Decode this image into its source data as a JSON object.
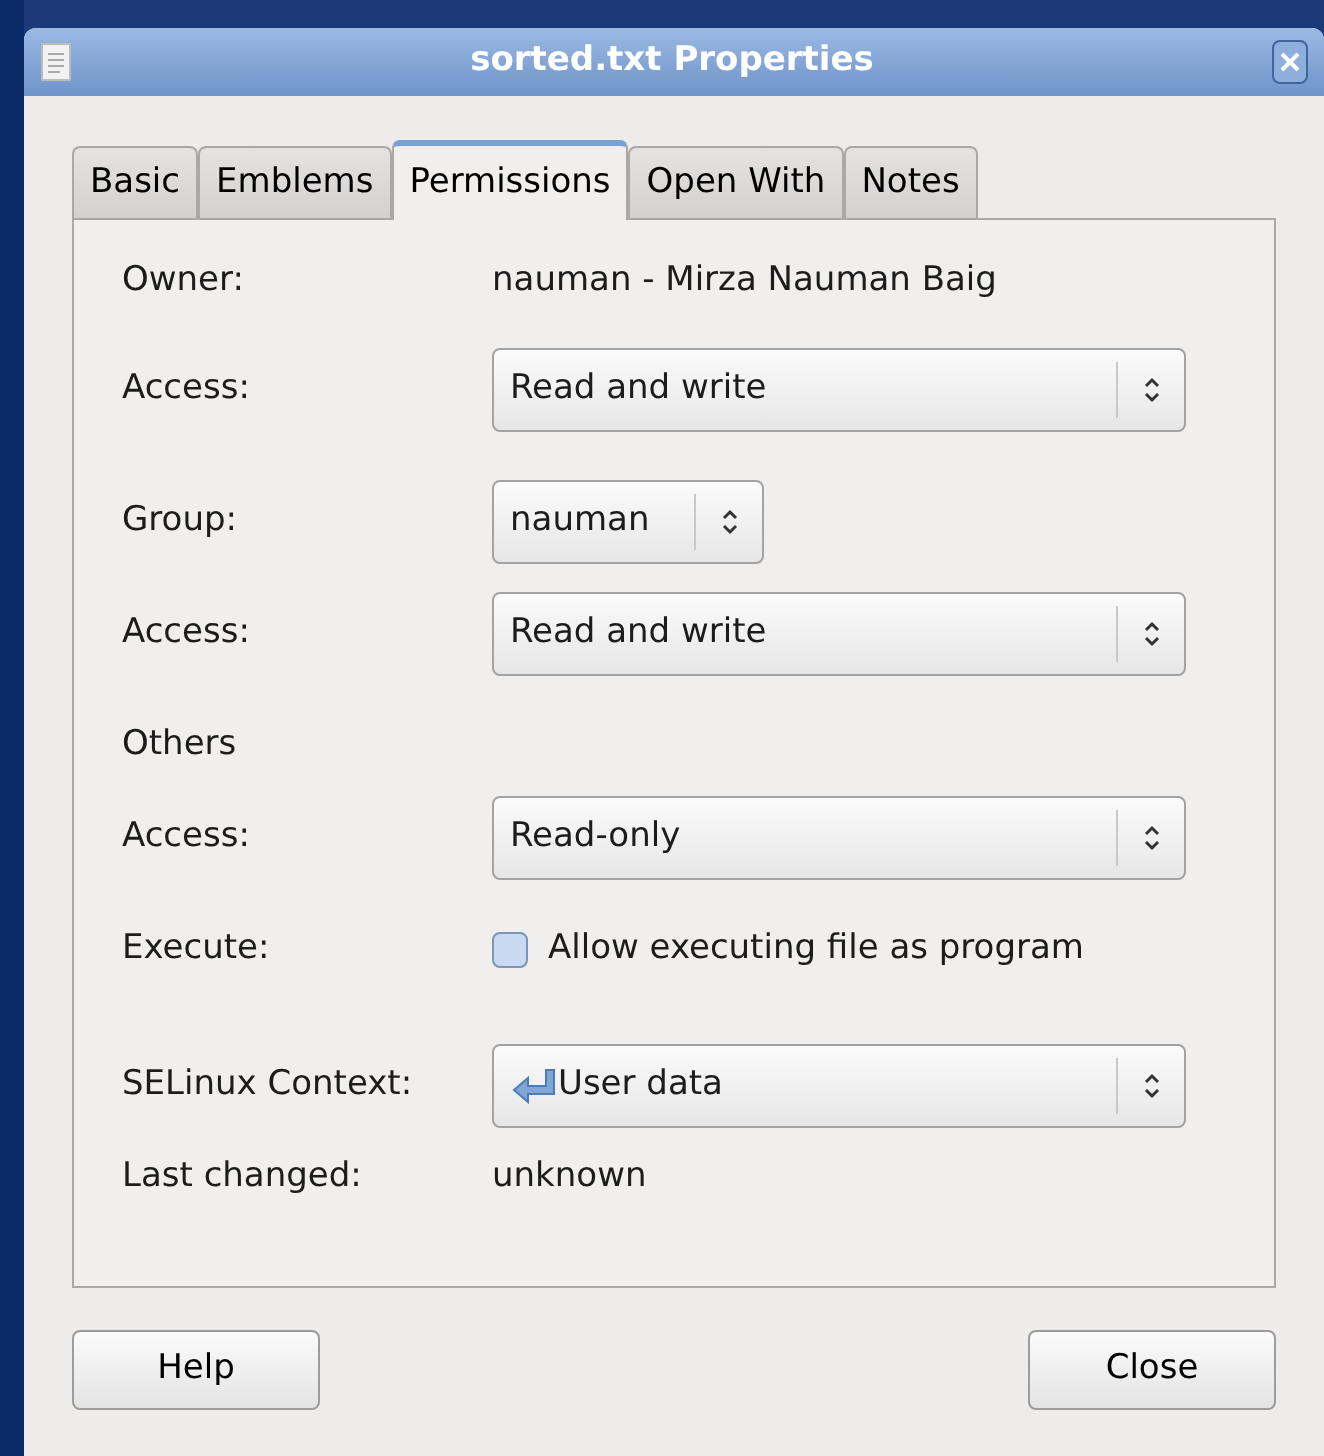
{
  "window": {
    "title": "sorted.txt Properties"
  },
  "tabs": [
    {
      "label": "Basic",
      "selected": false
    },
    {
      "label": "Emblems",
      "selected": false
    },
    {
      "label": "Permissions",
      "selected": true
    },
    {
      "label": "Open With",
      "selected": false
    },
    {
      "label": "Notes",
      "selected": false
    }
  ],
  "rows": [
    {
      "kind": "text",
      "label": "Owner:",
      "value": "nauman - Mirza Nauman Baig"
    },
    {
      "kind": "combo",
      "label": "Access:",
      "value": "Read and write",
      "wide": true
    },
    {
      "kind": "combo",
      "label": "Group:",
      "value": "nauman",
      "wide": false
    },
    {
      "kind": "combo",
      "label": "Access:",
      "value": "Read and write",
      "wide": true
    },
    {
      "kind": "heading",
      "label": "Others"
    },
    {
      "kind": "combo",
      "label": "Access:",
      "value": "Read-only",
      "wide": true
    },
    {
      "kind": "checkbox",
      "label": "Execute:",
      "value": "Allow executing file as program",
      "checked": false
    },
    {
      "kind": "combo",
      "label": "SELinux Context:",
      "value": "User data",
      "wide": true,
      "icon": true
    },
    {
      "kind": "text",
      "label": "Last changed:",
      "value": "unknown"
    }
  ],
  "buttons": [
    "Help",
    "Close"
  ]
}
